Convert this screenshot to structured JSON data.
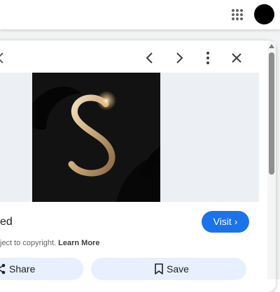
{
  "header": {
    "apps_icon": "apps-grid-icon",
    "avatar_color": "#000000"
  },
  "viewer": {
    "nav_icons": [
      "chevron-left-icon",
      "chevron-right-icon",
      "more-vert-icon",
      "close-icon"
    ],
    "image_description_icon": "gold-letter-s-logo",
    "title": "ed",
    "visit_label": "Visit",
    "copyright_text": "ject to copyright.",
    "learn_more_label": "Learn More",
    "share_label": "Share",
    "save_label": "Save"
  },
  "colors": {
    "accent": "#1a73e8",
    "pill_bg": "#e8f0fe"
  }
}
